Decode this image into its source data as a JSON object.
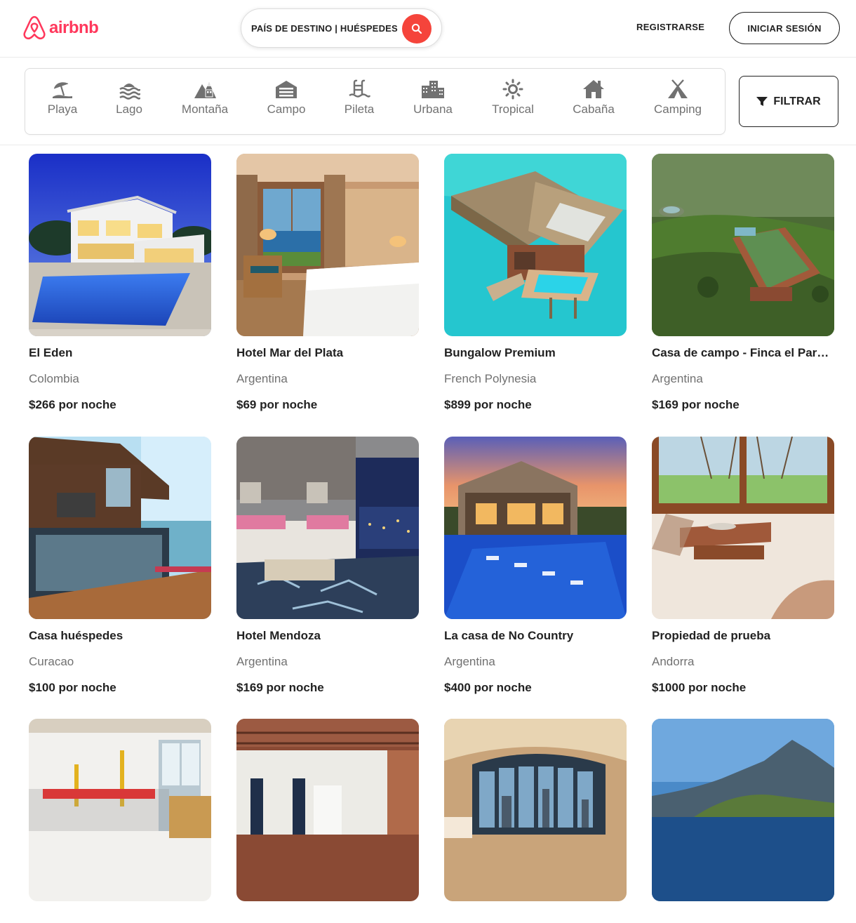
{
  "brand": {
    "name": "airbnb",
    "color": "#FF385C"
  },
  "header": {
    "search_placeholder": "PAÍS DE DESTINO | HUÉSPEDES",
    "search_button_color": "#F5443B",
    "signup_label": "REGISTRARSE",
    "login_label": "INICIAR SESIÓN"
  },
  "categories": [
    {
      "label": "Playa",
      "icon": "beach-umbrella-icon"
    },
    {
      "label": "Lago",
      "icon": "waves-icon"
    },
    {
      "label": "Montaña",
      "icon": "mountain-icon"
    },
    {
      "label": "Campo",
      "icon": "barn-icon"
    },
    {
      "label": "Pileta",
      "icon": "pool-ladder-icon"
    },
    {
      "label": "Urbana",
      "icon": "city-buildings-icon"
    },
    {
      "label": "Tropical",
      "icon": "sun-icon"
    },
    {
      "label": "Cabaña",
      "icon": "cabin-house-icon"
    },
    {
      "label": "Camping",
      "icon": "tent-icon"
    }
  ],
  "filter": {
    "label": "FILTRAR",
    "icon": "funnel-icon"
  },
  "listings": [
    {
      "title": "El Eden",
      "location": "Colombia",
      "price": "$266 por noche"
    },
    {
      "title": "Hotel Mar del Plata",
      "location": "Argentina",
      "price": "$69 por noche"
    },
    {
      "title": "Bungalow Premium",
      "location": "French Polynesia",
      "price": "$899 por noche"
    },
    {
      "title": "Casa de campo - Finca el Paraíso",
      "location": "Argentina",
      "price": "$169 por noche"
    },
    {
      "title": "Casa huéspedes",
      "location": "Curacao",
      "price": "$100 por noche"
    },
    {
      "title": "Hotel Mendoza",
      "location": "Argentina",
      "price": "$169 por noche"
    },
    {
      "title": "La casa de No Country",
      "location": "Argentina",
      "price": "$400 por noche"
    },
    {
      "title": "Propiedad de prueba",
      "location": "Andorra",
      "price": "$1000 por noche"
    },
    {
      "title": "",
      "location": "",
      "price": ""
    },
    {
      "title": "",
      "location": "",
      "price": ""
    },
    {
      "title": "",
      "location": "",
      "price": ""
    },
    {
      "title": "",
      "location": "",
      "price": ""
    }
  ]
}
